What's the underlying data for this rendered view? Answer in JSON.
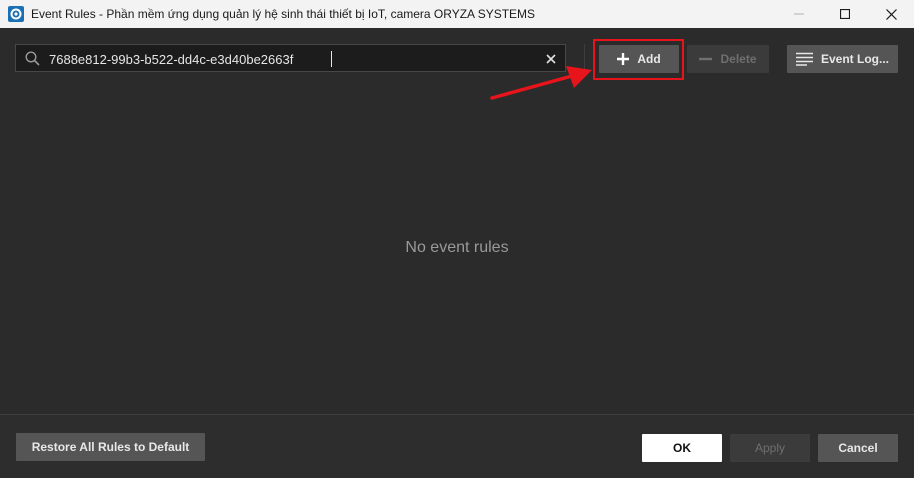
{
  "window": {
    "title": "Event Rules - Phần mềm ứng dụng quản lý hệ sinh thái thiết bị IoT, camera ORYZA SYSTEMS"
  },
  "search": {
    "value": "7688e812-99b3-b522-dd4c-e3d40be2663f",
    "placeholder": ""
  },
  "toolbar": {
    "add_label": "Add",
    "delete_label": "Delete",
    "event_log_label": "Event Log..."
  },
  "main": {
    "empty_message": "No event rules"
  },
  "footer": {
    "restore_label": "Restore All Rules to Default",
    "ok_label": "OK",
    "apply_label": "Apply",
    "cancel_label": "Cancel"
  },
  "colors": {
    "background": "#2b2b2b",
    "highlight": "#e8141b",
    "button": "#555555",
    "button_disabled": "#3b3b3b",
    "primary_button": "#ffffff"
  },
  "icons": [
    "app-icon",
    "minimize-icon",
    "maximize-icon",
    "close-icon",
    "search-icon",
    "clear-icon",
    "plus-icon",
    "minus-icon",
    "list-icon"
  ]
}
